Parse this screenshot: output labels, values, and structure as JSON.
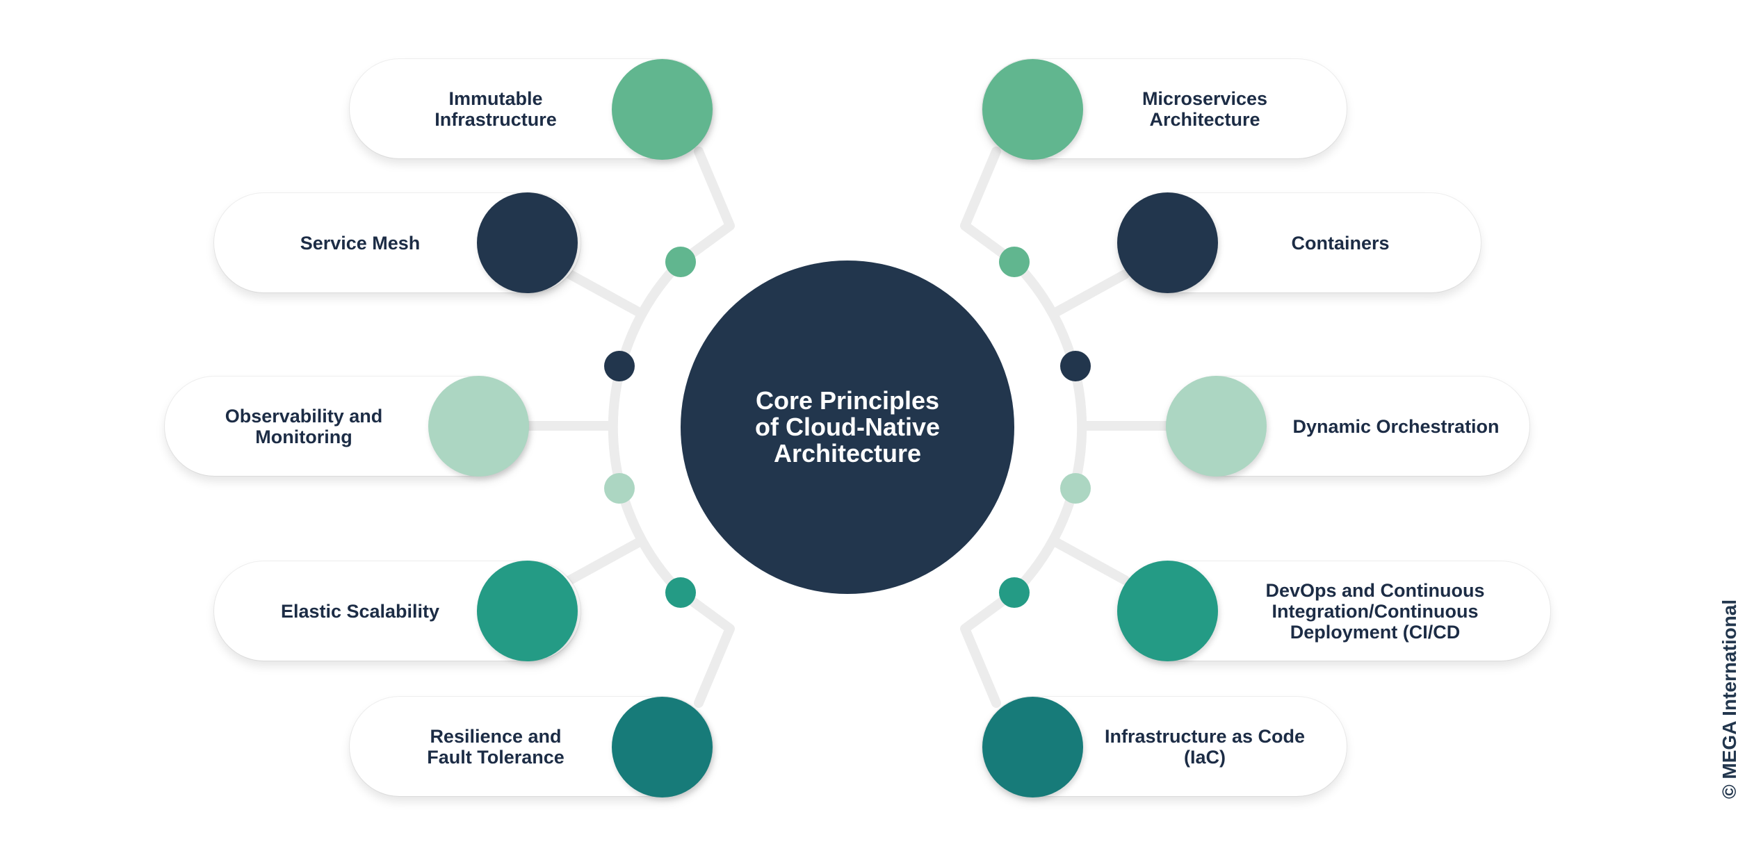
{
  "center": {
    "title": "Core Principles\nof Cloud-Native\nArchitecture",
    "color": "#22364d"
  },
  "colors": {
    "medium_green": "#61b68f",
    "navy": "#22364d",
    "light_green": "#acd6c2",
    "teal": "#249b85",
    "dark_teal": "#177b79"
  },
  "left_items": [
    {
      "label": "Immutable\nInfrastructure",
      "color": "#61b68f"
    },
    {
      "label": "Service Mesh",
      "color": "#22364d"
    },
    {
      "label": "Observability and\nMonitoring",
      "color": "#acd6c2"
    },
    {
      "label": "Elastic Scalability",
      "color": "#249b85"
    },
    {
      "label": "Resilience and\nFault Tolerance",
      "color": "#177b79"
    }
  ],
  "right_items": [
    {
      "label": "Microservices\nArchitecture",
      "color": "#61b68f"
    },
    {
      "label": "Containers",
      "color": "#22364d"
    },
    {
      "label": "Dynamic Orchestration",
      "color": "#acd6c2"
    },
    {
      "label": "DevOps and Continuous\nIntegration/Continuous\nDeployment (CI/CD",
      "color": "#249b85"
    },
    {
      "label": "Infrastructure as Code\n(IaC)",
      "color": "#177b79"
    }
  ],
  "connector_dots": [
    "#61b68f",
    "#22364d",
    "#acd6c2",
    "#249b85"
  ],
  "watermark": "© MEGA International"
}
